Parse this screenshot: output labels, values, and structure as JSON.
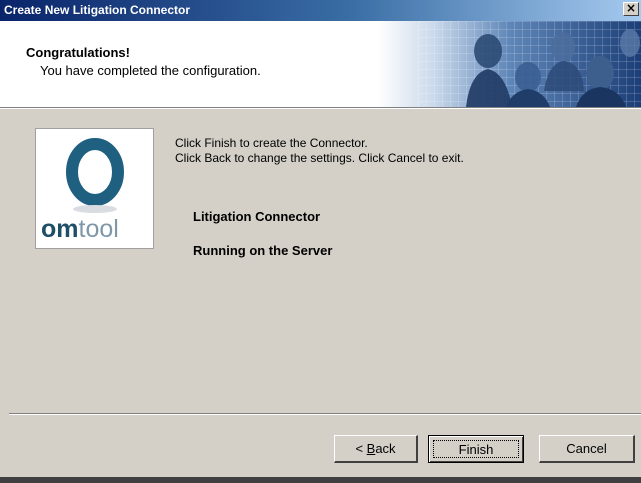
{
  "window": {
    "title": "Create New Litigation Connector",
    "close_glyph": "×"
  },
  "header": {
    "title": "Congratulations!",
    "subtitle": "You have completed the configuration."
  },
  "logo": {
    "brand_part1": "om",
    "brand_part2": "tool",
    "ring_color": "#1f5f80"
  },
  "body": {
    "instructions": [
      "Click Finish to create the Connector.",
      "Click Back to change the settings. Click Cancel to exit."
    ],
    "connector_name": "Litigation Connector",
    "connector_location": "Running on the Server"
  },
  "buttons": {
    "back_prefix": "< ",
    "back_mnemonic": "B",
    "back_rest": "ack",
    "finish": "Finish",
    "cancel": "Cancel"
  },
  "colors": {
    "title_bar_start": "#0a246a",
    "title_bar_end": "#a6caf0",
    "dialog_face": "#d4d0c8",
    "header_background": "#ffffff"
  }
}
